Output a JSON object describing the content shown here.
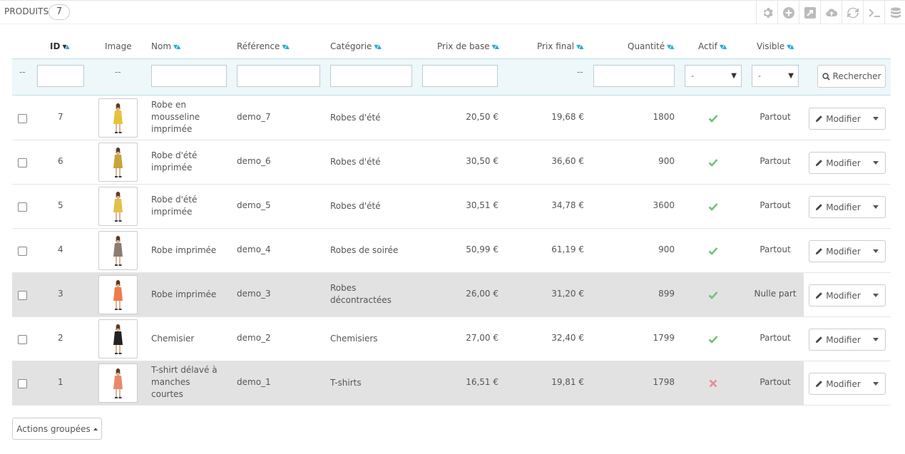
{
  "panel": {
    "title": "PRODUITS",
    "count": "7"
  },
  "toolbar": [
    "gear-icon",
    "add-icon",
    "export-icon",
    "cloud-upload-icon",
    "refresh-icon",
    "terminal-icon",
    "database-icon"
  ],
  "columns": {
    "id": "ID",
    "image": "Image",
    "name": "Nom",
    "reference": "Référence",
    "category": "Catégorie",
    "base_price": "Prix de base",
    "final_price": "Prix final",
    "quantity": "Quantité",
    "active": "Actif",
    "visible": "Visible"
  },
  "filters": {
    "id_dash": "--",
    "image_dash": "--",
    "final_dash": "--",
    "active_value": "-",
    "visible_value": "-",
    "search_label": "Rechercher"
  },
  "colors": {
    "accent": "#2eacce",
    "active_true": "#72c279",
    "active_false": "#e08f95",
    "filter_bg": "#eef7fa",
    "shade_bg": "#e2e2e2"
  },
  "products": [
    {
      "id": "7",
      "name": "Robe en mousseline imprimée",
      "reference": "demo_7",
      "category": "Robes d'été",
      "base_price": "20,50 €",
      "final_price": "19,68 €",
      "quantity": "1800",
      "active": true,
      "visible": "Partout",
      "dress_color": "#e8c23a",
      "shade": false
    },
    {
      "id": "6",
      "name": "Robe d'été imprimée",
      "reference": "demo_6",
      "category": "Robes d'été",
      "base_price": "30,50 €",
      "final_price": "36,60 €",
      "quantity": "900",
      "active": true,
      "visible": "Partout",
      "dress_color": "#c9a33b",
      "shade": false
    },
    {
      "id": "5",
      "name": "Robe d'été imprimée",
      "reference": "demo_5",
      "category": "Robes d'été",
      "base_price": "30,51 €",
      "final_price": "34,78 €",
      "quantity": "3600",
      "active": true,
      "visible": "Partout",
      "dress_color": "#e2c04a",
      "shade": false
    },
    {
      "id": "4",
      "name": "Robe imprimée",
      "reference": "demo_4",
      "category": "Robes de soirée",
      "base_price": "50,99 €",
      "final_price": "61,19 €",
      "quantity": "900",
      "active": true,
      "visible": "Partout",
      "dress_color": "#8a7d70",
      "shade": false
    },
    {
      "id": "3",
      "name": "Robe imprimée",
      "reference": "demo_3",
      "category": "Robes décontractées",
      "base_price": "26,00 €",
      "final_price": "31,20 €",
      "quantity": "899",
      "active": true,
      "visible": "Nulle part",
      "dress_color": "#f07a4a",
      "shade": true
    },
    {
      "id": "2",
      "name": "Chemisier",
      "reference": "demo_2",
      "category": "Chemisiers",
      "base_price": "27,00 €",
      "final_price": "32,40 €",
      "quantity": "1799",
      "active": true,
      "visible": "Partout",
      "dress_color": "#222222",
      "shade": false
    },
    {
      "id": "1",
      "name": "T-shirt délavé à manches courtes",
      "reference": "demo_1",
      "category": "T-shirts",
      "base_price": "16,51 €",
      "final_price": "19,81 €",
      "quantity": "1798",
      "active": false,
      "visible": "Partout",
      "dress_color": "#e88a6a",
      "shade": true
    }
  ],
  "row_action": {
    "edit_label": "Modifier"
  },
  "bulk": {
    "label": "Actions groupées"
  }
}
